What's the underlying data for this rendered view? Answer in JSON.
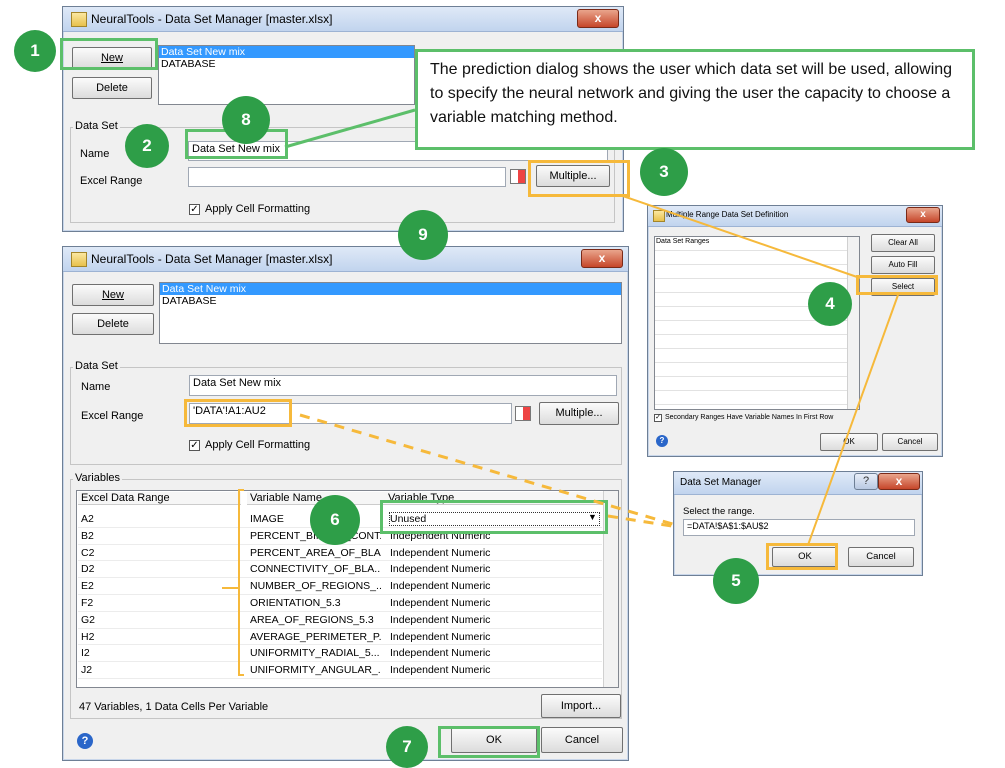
{
  "colors": {
    "step_circle": "#2e9e48",
    "highlight_yellow": "#f6b93b",
    "highlight_green": "#5cbf6a",
    "selection": "#3399ff",
    "arrow": "#f6b93b"
  },
  "win1": {
    "title": "NeuralTools - Data Set Manager [master.xlsx]",
    "close": "x",
    "new_btn": "New",
    "delete_btn": "Delete",
    "list": [
      "Data Set New mix",
      "DATABASE"
    ],
    "group_label": "Data Set",
    "name_label": "Name",
    "name_value": "Data Set New mix",
    "range_label": "Excel Range",
    "range_value": "",
    "multiple_btn": "Multiple...",
    "apply_label": "Apply Cell Formatting"
  },
  "callout": {
    "text": "The prediction dialog shows the user which data set will be used, allowing to specify the neural network and giving the user the capacity to choose a variable matching method."
  },
  "win2": {
    "title": "NeuralTools - Data Set Manager [master.xlsx]",
    "close": "x",
    "new_btn": "New",
    "delete_btn": "Delete",
    "list": [
      "Data Set New mix",
      "DATABASE"
    ],
    "group_label": "Data Set",
    "name_label": "Name",
    "name_value": "Data Set New mix",
    "range_label": "Excel Range",
    "range_value": "'DATA'!A1:AU2",
    "multiple_btn": "Multiple...",
    "apply_label": "Apply Cell Formatting",
    "variables_label": "Variables",
    "columns": [
      "Excel Data Range",
      "Variable Name",
      "Variable Type"
    ],
    "rows": [
      {
        "range": "A2",
        "name": "IMAGE",
        "type": "Unused"
      },
      {
        "range": "B2",
        "name": "PERCENT_BINARY_CONT...",
        "type": "Independent Numeric"
      },
      {
        "range": "C2",
        "name": "PERCENT_AREA_OF_BLA...",
        "type": "Independent Numeric"
      },
      {
        "range": "D2",
        "name": "CONNECTIVITY_OF_BLA...",
        "type": "Independent Numeric"
      },
      {
        "range": "E2",
        "name": "NUMBER_OF_REGIONS_...",
        "type": "Independent Numeric"
      },
      {
        "range": "F2",
        "name": "ORIENTATION_5.3",
        "type": "Independent Numeric"
      },
      {
        "range": "G2",
        "name": "AREA_OF_REGIONS_5.3",
        "type": "Independent Numeric"
      },
      {
        "range": "H2",
        "name": "AVERAGE_PERIMETER_P...",
        "type": "Independent Numeric"
      },
      {
        "range": "I2",
        "name": "UNIFORMITY_RADIAL_5...",
        "type": "Independent Numeric"
      },
      {
        "range": "J2",
        "name": "UNIFORMITY_ANGULAR_...",
        "type": "Independent Numeric"
      }
    ],
    "status": "47 Variables, 1 Data Cells Per Variable",
    "import_btn": "Import...",
    "ok_btn": "OK",
    "cancel_btn": "Cancel"
  },
  "win3": {
    "title": "Multiple Range Data Set Definition",
    "close": "x",
    "list_header": "Data Set Ranges",
    "clear_btn": "Clear All",
    "autofill_btn": "Auto Fill",
    "select_btn": "Select",
    "secondary_label": "Secondary Ranges Have Variable Names In First Row",
    "ok_btn": "OK",
    "cancel_btn": "Cancel"
  },
  "win4": {
    "title": "Data Set Manager",
    "help": "?",
    "close": "x",
    "prompt": "Select the range.",
    "value": "=DATA!$A$1:$AU$2",
    "ok_btn": "OK",
    "cancel_btn": "Cancel"
  },
  "steps": [
    "1",
    "2",
    "3",
    "4",
    "5",
    "6",
    "7",
    "8",
    "9"
  ]
}
